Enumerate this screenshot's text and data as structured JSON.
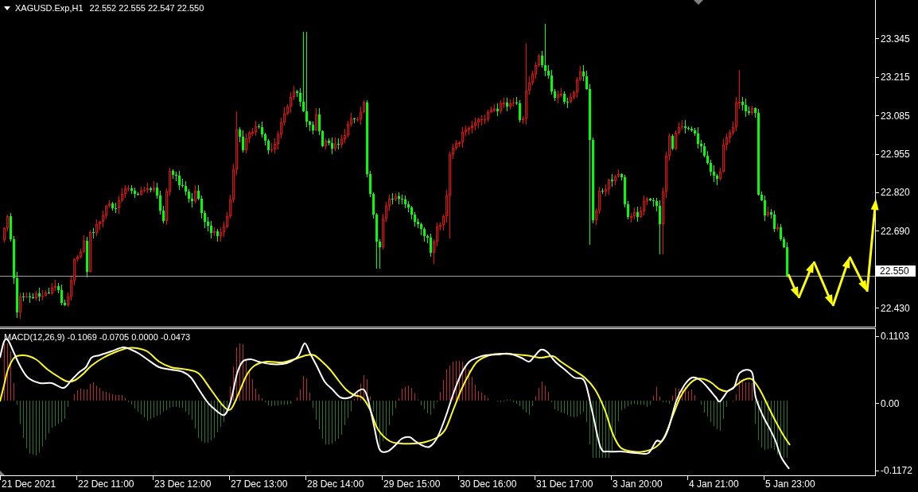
{
  "chart": {
    "header": {
      "symbol": "XAGUSD.Exp,H1",
      "quote": "22.552 22.555 22.547 22.550"
    },
    "price_axis": {
      "labels": [
        {
          "kind": "tick",
          "text": "23.345"
        },
        {
          "kind": "tick",
          "text": "23.215"
        },
        {
          "kind": "tick",
          "text": "23.085"
        },
        {
          "kind": "tick",
          "text": "22.955"
        },
        {
          "kind": "tick",
          "text": "22.820"
        },
        {
          "kind": "tick",
          "text": "22.690"
        },
        {
          "kind": "current",
          "text": "22.550"
        },
        {
          "kind": "tick",
          "text": "22.430"
        }
      ]
    }
  },
  "macd_panel": {
    "label": "MACD(12,26,9) -0.1069 -0.0705 0.0000 -0.0473",
    "axis_labels": [
      "0.1103",
      "0.00",
      "-0.1172"
    ]
  },
  "time_axis": {
    "labels": [
      "21 Dec 2021",
      "22 Dec 11:00",
      "23 Dec 12:00",
      "27 Dec 13:00",
      "28 Dec 14:00",
      "29 Dec 15:00",
      "30 Dec 16:00",
      "31 Dec 17:00",
      "3 Jan 20:00",
      "4 Jan 21:00",
      "5 Jan 23:00"
    ]
  }
}
